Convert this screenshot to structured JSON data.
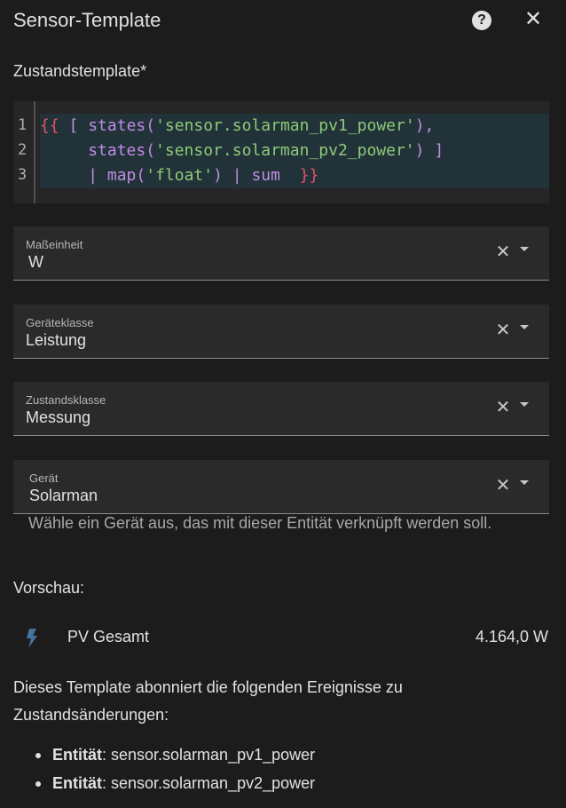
{
  "dialog": {
    "title": "Sensor-Template",
    "help_icon": "help-circle-icon",
    "close_icon": "close-icon"
  },
  "template_editor": {
    "label": "Zustandstemplate*",
    "line_numbers": [
      "1",
      "2",
      "3"
    ],
    "lines": [
      [
        {
          "t": "{{",
          "c": "brace"
        },
        {
          "t": " ",
          "c": ""
        },
        {
          "t": "[",
          "c": "fn"
        },
        {
          "t": " ",
          "c": ""
        },
        {
          "t": "states(",
          "c": "fn"
        },
        {
          "t": "'sensor.solarman_pv1_power'",
          "c": "str"
        },
        {
          "t": "),",
          "c": "fn"
        }
      ],
      [
        {
          "t": "     ",
          "c": ""
        },
        {
          "t": "states(",
          "c": "fn"
        },
        {
          "t": "'sensor.solarman_pv2_power'",
          "c": "str"
        },
        {
          "t": ")",
          "c": "fn"
        },
        {
          "t": " ",
          "c": ""
        },
        {
          "t": "]",
          "c": "fn"
        }
      ],
      [
        {
          "t": "     ",
          "c": ""
        },
        {
          "t": "|",
          "c": "pipe"
        },
        {
          "t": " ",
          "c": ""
        },
        {
          "t": "map(",
          "c": "fn"
        },
        {
          "t": "'float'",
          "c": "str"
        },
        {
          "t": ")",
          "c": "fn"
        },
        {
          "t": " ",
          "c": ""
        },
        {
          "t": "|",
          "c": "pipe"
        },
        {
          "t": " ",
          "c": ""
        },
        {
          "t": "sum",
          "c": "fn"
        },
        {
          "t": "  ",
          "c": ""
        },
        {
          "t": "}}",
          "c": "brace"
        }
      ]
    ],
    "colors": {
      "brace": "#e8506a",
      "fn": "#c08be6",
      "str": "#8fc97a",
      "highlight": "#213338"
    }
  },
  "fields": {
    "unit": {
      "label": "Maßeinheit",
      "value": "W"
    },
    "device_class": {
      "label": "Geräteklasse",
      "value": "Leistung"
    },
    "state_class": {
      "label": "Zustandsklasse",
      "value": "Messung"
    },
    "device": {
      "label": "Gerät",
      "value": "Solarman",
      "helper": "Wähle ein Gerät aus, das mit dieser Entität verknüpft werden soll."
    }
  },
  "preview": {
    "label": "Vorschau:",
    "entity_icon": "lightning-bolt-icon",
    "entity_name": "PV Gesamt",
    "entity_state": "4.164,0 W",
    "icon_color": "#44739e"
  },
  "subscriptions": {
    "text": "Dieses Template abonniert die folgenden Ereignisse zu Zustandsänderungen:",
    "items": [
      {
        "key": "Entität",
        "value": ": sensor.solarman_pv1_power"
      },
      {
        "key": "Entität",
        "value": ": sensor.solarman_pv2_power"
      }
    ]
  }
}
